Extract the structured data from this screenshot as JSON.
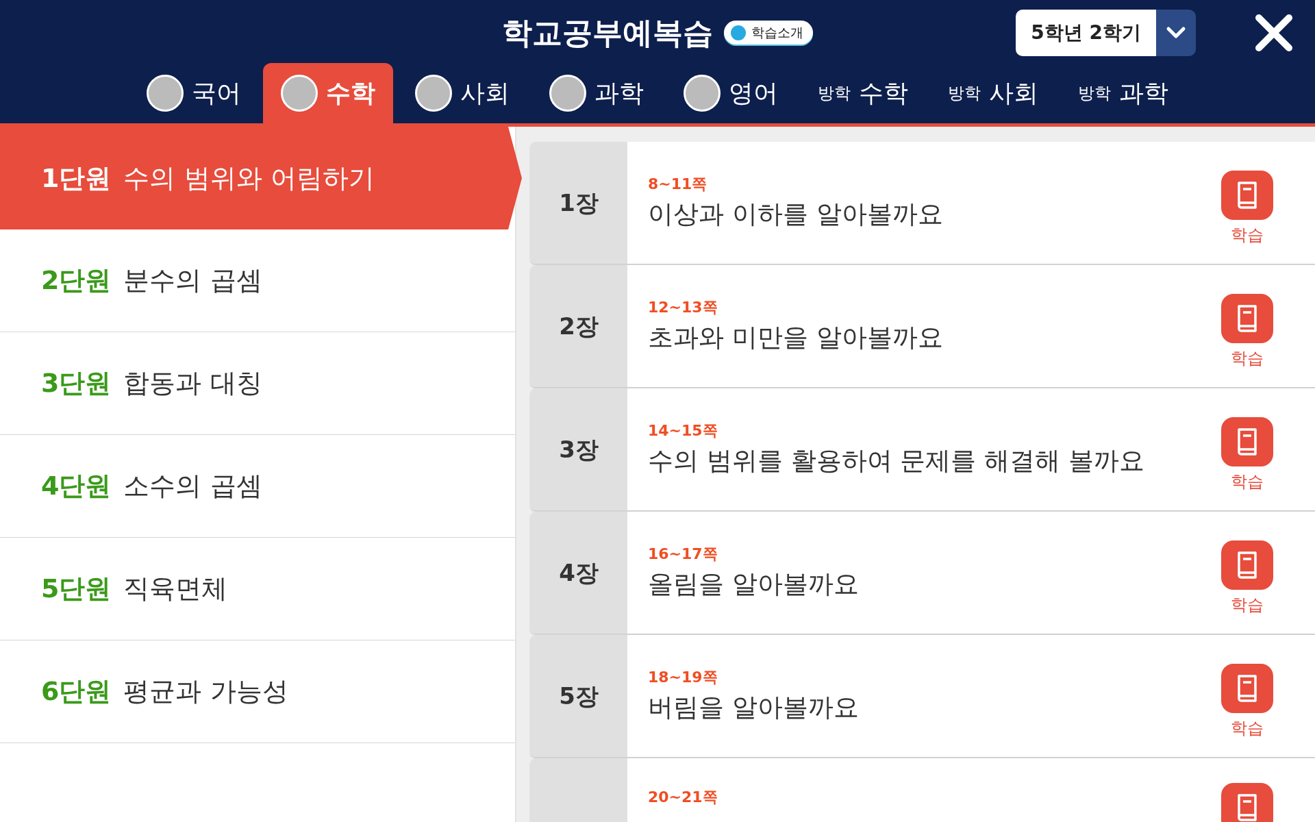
{
  "header": {
    "title": "학교공부예복습",
    "intro_button": "학습소개",
    "term_select": "5학년 2학기"
  },
  "tabs": [
    {
      "kind": "avatar",
      "label": "국어",
      "selected": false
    },
    {
      "kind": "avatar",
      "label": "수학",
      "selected": true
    },
    {
      "kind": "avatar",
      "label": "사회",
      "selected": false
    },
    {
      "kind": "avatar",
      "label": "과학",
      "selected": false
    },
    {
      "kind": "avatar",
      "label": "영어",
      "selected": false
    },
    {
      "kind": "vacation",
      "prefix": "방학",
      "label": "수학",
      "selected": false
    },
    {
      "kind": "vacation",
      "prefix": "방학",
      "label": "사회",
      "selected": false
    },
    {
      "kind": "vacation",
      "prefix": "방학",
      "label": "과학",
      "selected": false
    }
  ],
  "units": [
    {
      "number": "1단원",
      "title": "수의 범위와 어림하기",
      "selected": true
    },
    {
      "number": "2단원",
      "title": "분수의 곱셈",
      "selected": false
    },
    {
      "number": "3단원",
      "title": "합동과 대칭",
      "selected": false
    },
    {
      "number": "4단원",
      "title": "소수의 곱셈",
      "selected": false
    },
    {
      "number": "5단원",
      "title": "직육면체",
      "selected": false
    },
    {
      "number": "6단원",
      "title": "평균과 가능성",
      "selected": false
    }
  ],
  "lessons": [
    {
      "chapter": "1장",
      "pages": "8~11쪽",
      "title": "이상과 이하를 알아볼까요",
      "button": "학습"
    },
    {
      "chapter": "2장",
      "pages": "12~13쪽",
      "title": "초과와 미만을 알아볼까요",
      "button": "학습"
    },
    {
      "chapter": "3장",
      "pages": "14~15쪽",
      "title": "수의 범위를 활용하여 문제를 해결해 볼까요",
      "button": "학습"
    },
    {
      "chapter": "4장",
      "pages": "16~17쪽",
      "title": "올림을 알아볼까요",
      "button": "학습"
    },
    {
      "chapter": "5장",
      "pages": "18~19쪽",
      "title": "버림을 알아볼까요",
      "button": "학습"
    },
    {
      "pages": "20~21쪽"
    }
  ]
}
